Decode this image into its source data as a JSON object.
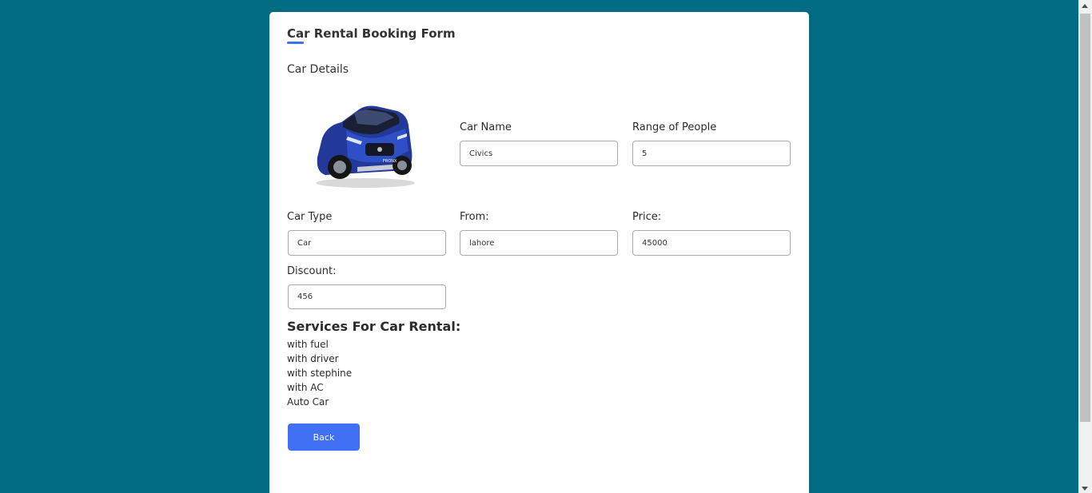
{
  "form": {
    "title": "Car Rental Booking Form",
    "section": "Car Details",
    "car_image": "car-image",
    "fields": {
      "car_name": {
        "label": "Car Name",
        "value": "Civics"
      },
      "range_of_people": {
        "label": "Range of People",
        "value": "5"
      },
      "car_type": {
        "label": "Car Type",
        "value": "Car"
      },
      "from": {
        "label": "From:",
        "value": "lahore"
      },
      "price": {
        "label": "Price:",
        "value": "45000"
      },
      "discount": {
        "label": "Discount:",
        "value": "456"
      }
    },
    "services": {
      "heading": "Services For Car Rental:",
      "items": [
        "with fuel",
        "with driver",
        "with stephine",
        "with AC",
        "Auto Car"
      ]
    },
    "back_label": "Back"
  },
  "colors": {
    "page_background": "#016b84",
    "accent": "#4070f4",
    "card": "#ffffff"
  }
}
